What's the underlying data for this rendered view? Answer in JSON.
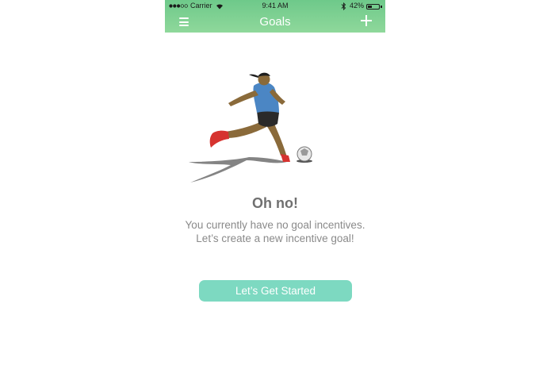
{
  "status_bar": {
    "carrier": "Carrier",
    "time": "9:41 AM",
    "battery_percent": "42%",
    "battery_level": 0.42
  },
  "nav": {
    "title": "Goals",
    "menu_icon": "hamburger-menu-icon",
    "add_icon": "plus-icon"
  },
  "empty_state": {
    "illustration": "soccer-player-kicking-ball",
    "heading": "Oh no!",
    "message_line1": "You currently have no goal incentives.",
    "message_line2": "Let’s create a new incentive goal!",
    "button_label": "Let’s Get Started"
  },
  "colors": {
    "header_gradient_top": "#6ec98a",
    "header_gradient_bottom": "#8fd89b",
    "button": "#7dd9c1",
    "heading_text": "#707070",
    "body_text": "#8a8a8a"
  }
}
